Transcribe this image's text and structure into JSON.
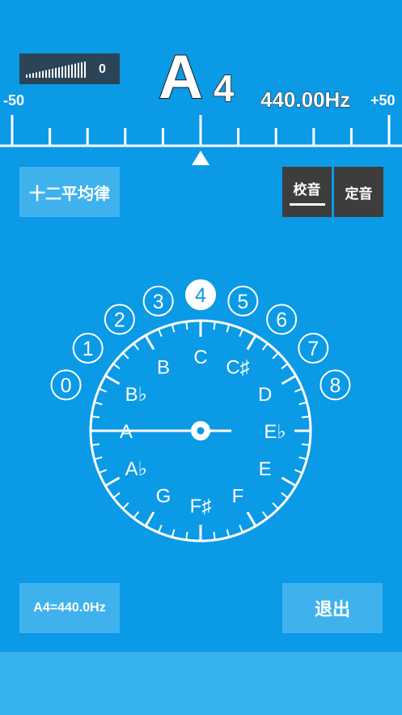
{
  "meter": {
    "level": "0",
    "bar_count": 19
  },
  "note": {
    "letter": "A",
    "octave": "4",
    "frequency": "440.00Hz"
  },
  "scale": {
    "left": "-50",
    "right": "+50",
    "needle_cents": 0
  },
  "buttons": {
    "temperament": "十二平均律",
    "tune": "校音",
    "fix": "定音",
    "reference": "A4=440.0Hz",
    "exit": "退出"
  },
  "dial": {
    "octaves": [
      "0",
      "1",
      "2",
      "3",
      "4",
      "5",
      "6",
      "7",
      "8"
    ],
    "selected_octave": "4",
    "notes": [
      {
        "label": "C",
        "angle": 0
      },
      {
        "label": "C♯",
        "angle": 30
      },
      {
        "label": "D",
        "angle": 60
      },
      {
        "label": "E♭",
        "angle": 90
      },
      {
        "label": "E",
        "angle": 120
      },
      {
        "label": "F",
        "angle": 150
      },
      {
        "label": "F♯",
        "angle": 180
      },
      {
        "label": "G",
        "angle": 210
      },
      {
        "label": "A♭",
        "angle": 240
      },
      {
        "label": "A",
        "angle": 270
      },
      {
        "label": "B♭",
        "angle": 300
      },
      {
        "label": "B",
        "angle": 330
      }
    ],
    "pointer_note": "A"
  },
  "colors": {
    "background": "#0a9ae6",
    "button": "#3fb2ee",
    "dark_button": "#3d3d3d",
    "meter_bg": "#2c4458"
  }
}
